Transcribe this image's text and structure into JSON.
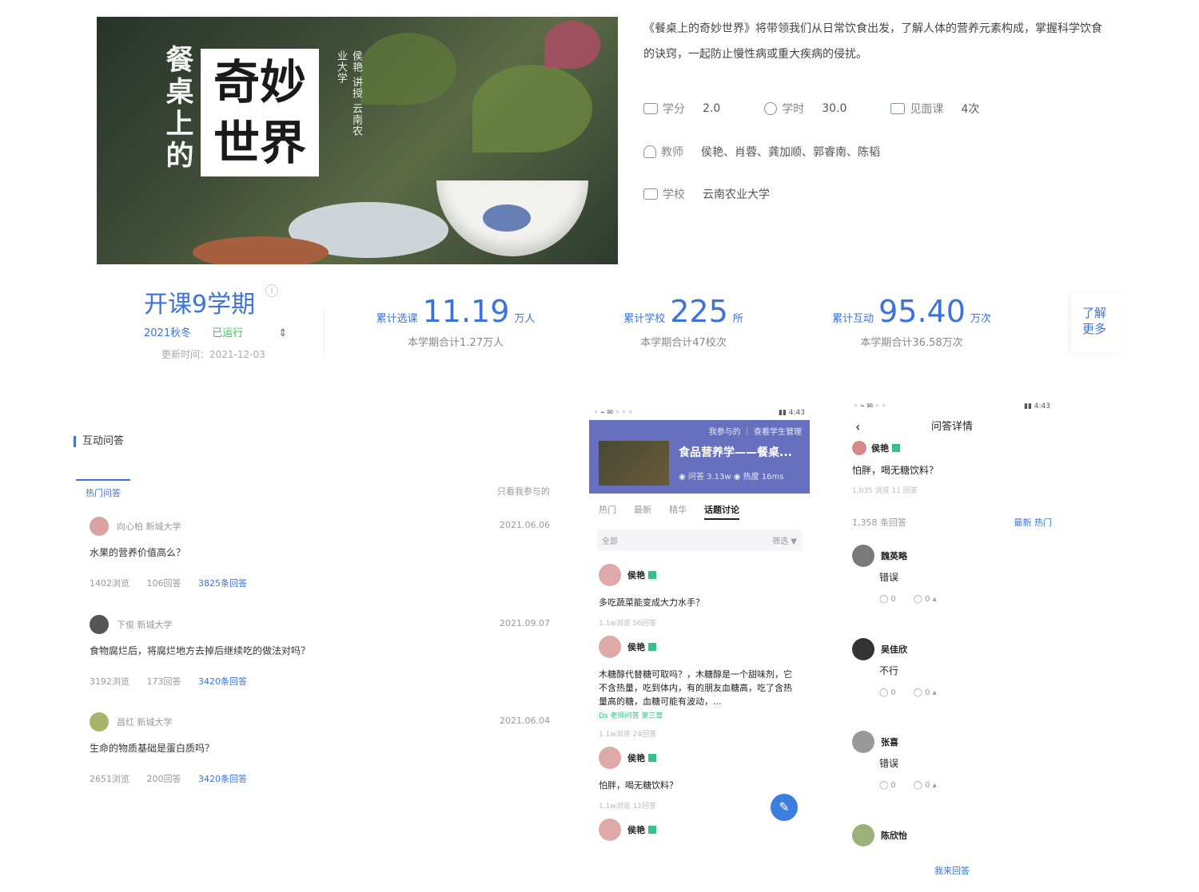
{
  "course": {
    "banner_title_vertical": "餐桌上的",
    "banner_title_box": "奇妙世界",
    "banner_subtitle": "侯艳 讲授 云南农业大学",
    "description": "《餐桌上的奇妙世界》将带领我们从日常饮食出发，了解人体的营养元素构成，掌握科学饮食的诀窍，一起防止慢性病或重大疾病的侵扰。",
    "credit_label": "学分",
    "credit_value": "2.0",
    "hours_label": "学时",
    "hours_value": "30.0",
    "meeting_label": "见面课",
    "meeting_value": "4次",
    "teacher_label": "教师",
    "teacher_value": "侯艳、肖蓉、龚加顺、郭睿南、陈韬",
    "school_label": "学校",
    "school_value": "云南农业大学"
  },
  "stats": {
    "term_title": "开课9学期",
    "term_info": "i",
    "term_season": "2021秋冬",
    "term_status": "已运行",
    "term_switch": "⇕",
    "term_updated": "更新时间：2021-12-03",
    "enroll": {
      "label": "累计选课",
      "value": "11.19",
      "unit": "万人",
      "sub": "本学期合计1.27万人"
    },
    "schools": {
      "label": "累计学校",
      "value": "225",
      "unit": "所",
      "sub": "本学期合计47校次"
    },
    "interact": {
      "label": "累计互动",
      "value": "95.40",
      "unit": "万次",
      "sub": "本学期合计36.58万次"
    },
    "more_label": "了解更多"
  },
  "qa": {
    "section_title": "互动问答",
    "tab_label": "热门问答",
    "sort_label": "只看我参与的",
    "items": [
      {
        "user": "向心柏 新城大学",
        "date": "2021.06.06",
        "question": "水果的营养价值高么？",
        "views": "1402浏览",
        "comments": "106回答",
        "answer": "3825条回答"
      },
      {
        "user": "下俊 新城大学",
        "date": "2021.09.07",
        "question": "食物腐烂后，将腐烂地方去掉后继续吃的做法对吗？",
        "views": "3192浏览",
        "comments": "173回答",
        "answer": "3420条回答"
      },
      {
        "user": "昌红 新城大学",
        "date": "2021.06.04",
        "question": "生命的物质基础是蛋白质吗？",
        "views": "2651浏览",
        "comments": "200回答",
        "answer": "3420条回答"
      }
    ]
  },
  "phone1": {
    "status_left": "◦ ⌁ ✉ ◦ ◦ ◦",
    "status_right": "▮▮ 4:43",
    "crumbs": "我参与的 ｜ 查看学生管理",
    "course_title": "食品营养学——餐桌...",
    "course_sub": "◉ 问答 3.13w   ◉ 热度 16ms",
    "tabs": [
      "热门",
      "最新",
      "精华",
      "话题讨论"
    ],
    "filter_left": "全部",
    "filter_right": "筛选 ▼",
    "posts": [
      {
        "user": "侯艳",
        "question": "多吃蔬菜能变成大力水手？",
        "tag": "",
        "meta": "1.1w浏览   56回答"
      },
      {
        "user": "侯艳",
        "question": "木糖醇代替糖可取吗？，木糖醇是一个甜味剂，它不含热量，吃到体内，有的朋友血糖高，吃了含热量高的糖，血糖可能有波动，...",
        "tag": "Ds  老师问答 第三章",
        "meta": "1.1w浏览   24回答"
      },
      {
        "user": "侯艳",
        "question": "怕胖，喝无糖饮料？",
        "tag": "",
        "meta": "1.1w浏览   11回答"
      },
      {
        "user": "侯艳",
        "question": "",
        "tag": "",
        "meta": ""
      }
    ],
    "fab": "✎"
  },
  "phone2": {
    "status_left": "◦ ⌁ ✉ ◦ ◦",
    "status_right": "▮▮ 4:43",
    "back": "‹",
    "nav_title": "问答详情",
    "asker": "侯艳",
    "question": "怕胖，喝无糖饮料？",
    "qmeta": "1,035 浏览   11 回答",
    "answer_count": "1,358 条回答",
    "sort": "最新  热门",
    "answers": [
      {
        "user": "魏英略",
        "text": "错误",
        "likes": "◯ 0",
        "replies": "◯ 0 ▴"
      },
      {
        "user": "吴佳欣",
        "text": "不行",
        "likes": "◯ 0",
        "replies": "◯ 0 ▴"
      },
      {
        "user": "张喜",
        "text": "错误",
        "likes": "◯ 0",
        "replies": "◯ 0 ▴"
      },
      {
        "user": "陈欣怡",
        "text": "",
        "likes": "",
        "replies": ""
      }
    ],
    "more": "我来回答"
  },
  "colors": {
    "accent": "#3d73d9",
    "ok": "#37c45a",
    "phone_header": "#6670bf",
    "fab": "#3b7ee0"
  }
}
